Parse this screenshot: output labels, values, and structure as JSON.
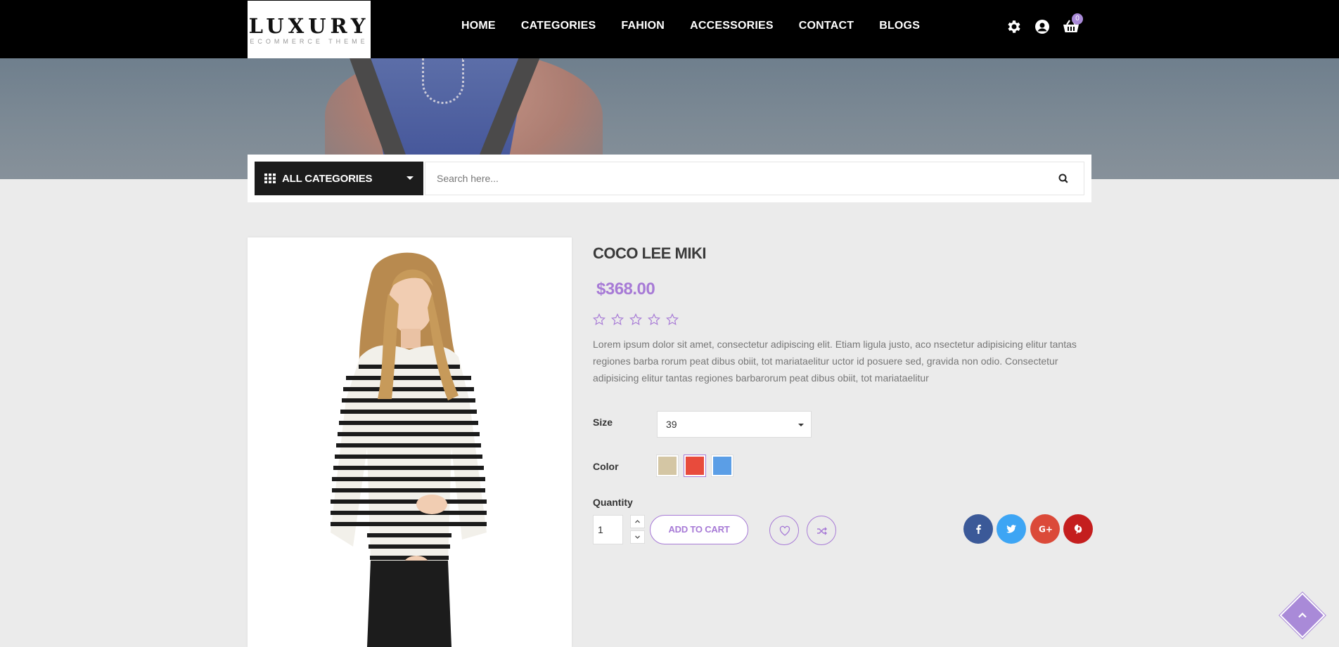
{
  "header": {
    "logo": {
      "brand": "LUXURY",
      "tagline": "ECOMMERCE THEME"
    },
    "nav": [
      {
        "label": "HOME",
        "name": "nav-home"
      },
      {
        "label": "CATEGORIES",
        "name": "nav-categories"
      },
      {
        "label": "FAHION",
        "name": "nav-fahion"
      },
      {
        "label": "ACCESSORIES",
        "name": "nav-accessories"
      },
      {
        "label": "CONTACT",
        "name": "nav-contact"
      },
      {
        "label": "BLOGS",
        "name": "nav-blogs"
      }
    ],
    "icons": [
      "settings-gear-icon",
      "user-account-icon",
      "shopping-basket-icon"
    ],
    "cart_count": "0",
    "badge_color": "#a98ad8"
  },
  "search": {
    "category_label": "ALL CATEGORIES",
    "placeholder": "Search here...",
    "icon": "search-icon"
  },
  "product": {
    "title": "COCO LEE MIKI",
    "price": "$368.00",
    "rating": 0,
    "rating_max": 5,
    "description": "Lorem ipsum dolor sit amet, consectetur adipiscing elit. Etiam ligula justo, aco nsectetur adipisicing elitur tantas regiones barba rorum peat dibus obiit, tot mariataelitur uctor id posuere sed, gravida non odio. Consectetur adipisicing elitur tantas regiones barbarorum peat dibus obiit, tot mariataelitur",
    "size_label": "Size",
    "size_value": "39",
    "color_label": "Color",
    "colors": [
      "#d4c6a4",
      "#e84b3c",
      "#5b9ee6"
    ],
    "selected_color": "#e84b3c",
    "quantity_label": "Quantity",
    "quantity_value": "1",
    "add_to_cart_label": "ADD TO CART",
    "accent_color": "#a77ad6"
  },
  "share": [
    {
      "name": "facebook-share-button",
      "icon": "facebook-icon",
      "color": "#3b5998"
    },
    {
      "name": "twitter-share-button",
      "icon": "twitter-icon",
      "color": "#3da5f4"
    },
    {
      "name": "google-plus-share-button",
      "icon": "google-plus-icon",
      "color": "#db4a39"
    },
    {
      "name": "pinterest-share-button",
      "icon": "pinterest-icon",
      "color": "#c41e1e"
    }
  ]
}
